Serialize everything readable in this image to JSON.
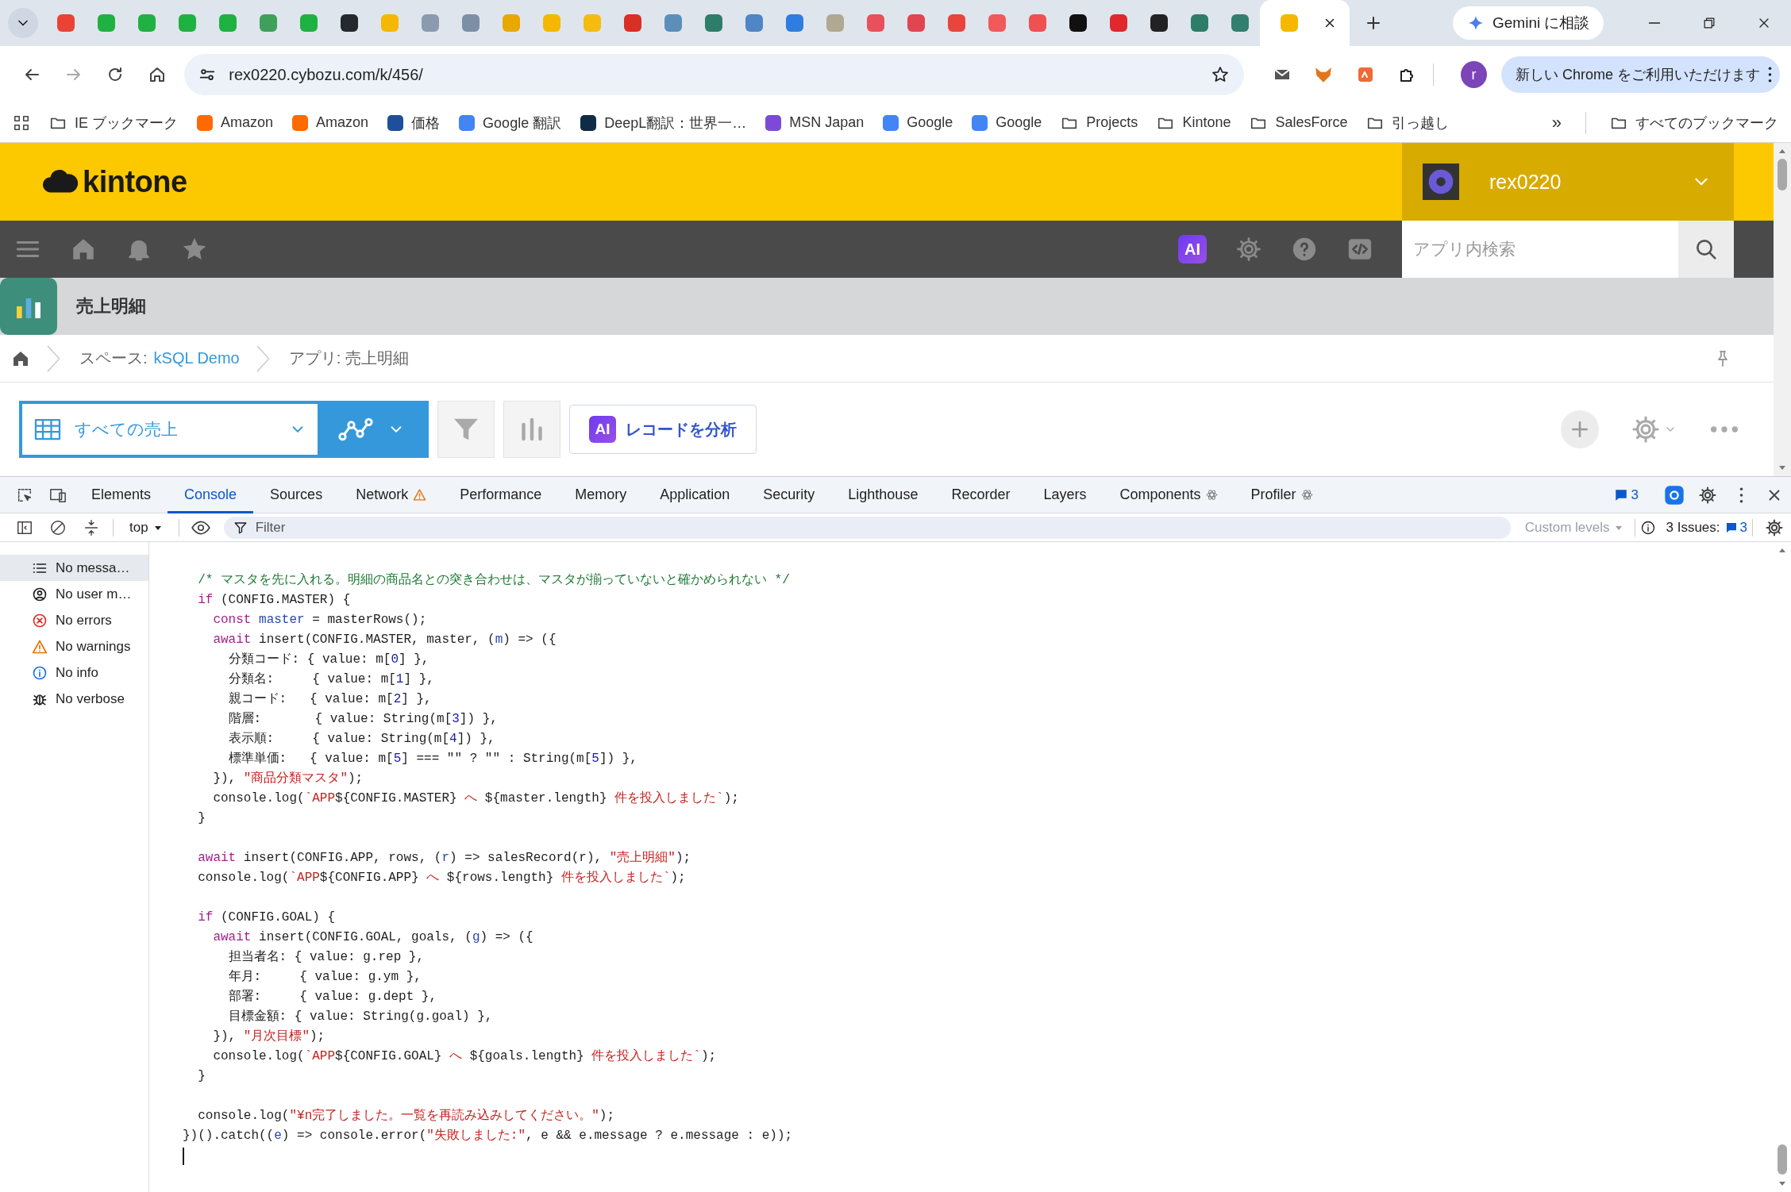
{
  "browser": {
    "tabs": [
      {
        "color": "#ea4335",
        "selected": false
      },
      {
        "color": "#1fb141",
        "selected": false
      },
      {
        "color": "#1fb141",
        "selected": false
      },
      {
        "color": "#1fb141",
        "selected": false
      },
      {
        "color": "#1fb141",
        "selected": false
      },
      {
        "color": "#3fa05a",
        "selected": false
      },
      {
        "color": "#1fb141",
        "selected": false
      },
      {
        "color": "#24292f",
        "selected": false
      },
      {
        "color": "#f6b700",
        "selected": false
      },
      {
        "color": "#8a9bb0",
        "selected": false
      },
      {
        "color": "#7d8fa6",
        "selected": false
      },
      {
        "color": "#e8a800",
        "selected": false
      },
      {
        "color": "#f6b700",
        "selected": false
      },
      {
        "color": "#f5bb10",
        "selected": false
      },
      {
        "color": "#d93025",
        "selected": false
      },
      {
        "color": "#5b8fb9",
        "selected": false
      },
      {
        "color": "#2e7d6b",
        "selected": false
      },
      {
        "color": "#4f86c6",
        "selected": false
      },
      {
        "color": "#2f7de1",
        "selected": false
      },
      {
        "color": "#b0a890",
        "selected": false
      },
      {
        "color": "#e8505b",
        "selected": false
      },
      {
        "color": "#e04550",
        "selected": false
      },
      {
        "color": "#e8453c",
        "selected": false
      },
      {
        "color": "#f05a5a",
        "selected": false
      },
      {
        "color": "#ef5050",
        "selected": false
      },
      {
        "color": "#111111",
        "selected": false
      },
      {
        "color": "#e0282d",
        "selected": false
      },
      {
        "color": "#222222",
        "selected": false
      },
      {
        "color": "#2e7d6b",
        "selected": false
      },
      {
        "color": "#327f70",
        "selected": false
      },
      {
        "color": "#f6b700",
        "selected": true
      }
    ],
    "gemini_button": "Gemini に相談",
    "address": "rex0220.cybozu.com/k/456/",
    "profile_initial": "r",
    "update_button": "新しい Chrome をご利用いただけます",
    "bookmarks": [
      {
        "label": "IE ブックマーク",
        "kind": "folder"
      },
      {
        "label": "Amazon",
        "kind": "site",
        "color": "#ff6a00"
      },
      {
        "label": "Amazon",
        "kind": "site",
        "color": "#ff6a00"
      },
      {
        "label": "価格",
        "kind": "site",
        "color": "#1d4f9c"
      },
      {
        "label": "Google 翻訳",
        "kind": "site",
        "color": "#4285f4"
      },
      {
        "label": "DeepL翻訳：世界一…",
        "kind": "site",
        "color": "#0f2b46"
      },
      {
        "label": "MSN Japan",
        "kind": "site",
        "color": "#7b4bd8"
      },
      {
        "label": "Google",
        "kind": "site",
        "color": "#4285f4"
      },
      {
        "label": "Google",
        "kind": "site",
        "color": "#4285f4"
      },
      {
        "label": "Projects",
        "kind": "folder"
      },
      {
        "label": "Kintone",
        "kind": "folder"
      },
      {
        "label": "SalesForce",
        "kind": "folder"
      },
      {
        "label": "引っ越し",
        "kind": "folder"
      }
    ],
    "more_bookmarks": "»",
    "all_bookmarks": "すべてのブックマーク"
  },
  "kintone": {
    "logo": "kintone",
    "user": "rex0220",
    "ai_badge": "AI",
    "search": {
      "placeholder": "アプリ内検索"
    },
    "app_title": "売上明細",
    "breadcrumb": {
      "space_label": "スペース:",
      "space_link": "kSQL Demo",
      "app": "アプリ: 売上明細"
    },
    "view": "すべての売上",
    "analyze_button": {
      "badge": "AI",
      "label": "レコードを分析"
    }
  },
  "devtools": {
    "tabs": [
      {
        "label": "Elements",
        "kind": "plain",
        "selected": false
      },
      {
        "label": "Console",
        "kind": "plain",
        "selected": true
      },
      {
        "label": "Sources",
        "kind": "plain",
        "selected": false
      },
      {
        "label": "Network",
        "kind": "warning",
        "selected": false
      },
      {
        "label": "Performance",
        "kind": "plain",
        "selected": false
      },
      {
        "label": "Memory",
        "kind": "plain",
        "selected": false
      },
      {
        "label": "Application",
        "kind": "plain",
        "selected": false
      },
      {
        "label": "Security",
        "kind": "plain",
        "selected": false
      },
      {
        "label": "Lighthouse",
        "kind": "plain",
        "selected": false
      },
      {
        "label": "Recorder",
        "kind": "plain",
        "selected": false
      },
      {
        "label": "Layers",
        "kind": "plain",
        "selected": false
      },
      {
        "label": "Components",
        "kind": "react",
        "selected": false
      },
      {
        "label": "Profiler",
        "kind": "react",
        "selected": false
      }
    ],
    "message_count": "3",
    "context": "top",
    "filter": {
      "placeholder": "Filter"
    },
    "levels": {
      "label": "Custom levels",
      "disabled": true
    },
    "issues_label": "3 Issues:",
    "issues_count": "3",
    "sidebar": [
      {
        "label": "No messa…",
        "kind": "list",
        "selected": true
      },
      {
        "label": "No user m…",
        "kind": "user",
        "selected": false
      },
      {
        "label": "No errors",
        "kind": "error",
        "selected": false
      },
      {
        "label": "No warnings",
        "kind": "warning",
        "selected": false
      },
      {
        "label": "No info",
        "kind": "info",
        "selected": false
      },
      {
        "label": "No verbose",
        "kind": "verbose",
        "selected": false
      }
    ],
    "code": [
      {
        "tokens": [
          {
            "kind": "comment",
            "text": "  /* マスタを先に入れる。明細の商品名との突き合わせは、マスタが揃っていないと確かめられない */"
          }
        ]
      },
      {
        "tokens": [
          {
            "kind": "keyword",
            "text": "  if"
          },
          {
            "kind": "plain",
            "text": " (CONFIG.MASTER) {"
          }
        ]
      },
      {
        "tokens": [
          {
            "kind": "keyword",
            "text": "    const"
          },
          {
            "kind": "variable",
            "text": " master"
          },
          {
            "kind": "plain",
            "text": " = masterRows();"
          }
        ]
      },
      {
        "tokens": [
          {
            "kind": "keyword",
            "text": "    await"
          },
          {
            "kind": "plain",
            "text": " insert(CONFIG.MASTER, master, ("
          },
          {
            "kind": "variable",
            "text": "m"
          },
          {
            "kind": "plain",
            "text": ") => ({"
          }
        ]
      },
      {
        "tokens": [
          {
            "kind": "plain",
            "text": "      分類コード: { value: m["
          },
          {
            "kind": "number",
            "text": "0"
          },
          {
            "kind": "plain",
            "text": "] },"
          }
        ]
      },
      {
        "tokens": [
          {
            "kind": "plain",
            "text": "      分類名:     { value: m["
          },
          {
            "kind": "number",
            "text": "1"
          },
          {
            "kind": "plain",
            "text": "] },"
          }
        ]
      },
      {
        "tokens": [
          {
            "kind": "plain",
            "text": "      親コード:   { value: m["
          },
          {
            "kind": "number",
            "text": "2"
          },
          {
            "kind": "plain",
            "text": "] },"
          }
        ]
      },
      {
        "tokens": [
          {
            "kind": "plain",
            "text": "      階層:       { value: String(m["
          },
          {
            "kind": "number",
            "text": "3"
          },
          {
            "kind": "plain",
            "text": "]) },"
          }
        ]
      },
      {
        "tokens": [
          {
            "kind": "plain",
            "text": "      表示順:     { value: String(m["
          },
          {
            "kind": "number",
            "text": "4"
          },
          {
            "kind": "plain",
            "text": "]) },"
          }
        ]
      },
      {
        "tokens": [
          {
            "kind": "plain",
            "text": "      標準単価:   { value: m["
          },
          {
            "kind": "number",
            "text": "5"
          },
          {
            "kind": "plain",
            "text": "] === \"\" ? \"\" : String(m["
          },
          {
            "kind": "number",
            "text": "5"
          },
          {
            "kind": "plain",
            "text": "]) },"
          }
        ]
      },
      {
        "tokens": [
          {
            "kind": "plain",
            "text": "    }), "
          },
          {
            "kind": "string",
            "text": "\"商品分類マスタ\""
          },
          {
            "kind": "plain",
            "text": ");"
          }
        ]
      },
      {
        "tokens": [
          {
            "kind": "plain",
            "text": "    console.log("
          },
          {
            "kind": "string",
            "text": "`APP"
          },
          {
            "kind": "plain",
            "text": "${CONFIG.MASTER}"
          },
          {
            "kind": "string",
            "text": " へ "
          },
          {
            "kind": "plain",
            "text": "${master.length}"
          },
          {
            "kind": "string",
            "text": " 件を投入しました`"
          },
          {
            "kind": "plain",
            "text": ");"
          }
        ]
      },
      {
        "tokens": [
          {
            "kind": "plain",
            "text": "  }"
          }
        ]
      },
      {
        "blank_before": true,
        "tokens": [
          {
            "kind": "keyword",
            "text": "  await"
          },
          {
            "kind": "plain",
            "text": " insert(CONFIG.APP, rows, ("
          },
          {
            "kind": "variable",
            "text": "r"
          },
          {
            "kind": "plain",
            "text": ") => salesRecord(r), "
          },
          {
            "kind": "string",
            "text": "\"売上明細\""
          },
          {
            "kind": "plain",
            "text": ");"
          }
        ]
      },
      {
        "tokens": [
          {
            "kind": "plain",
            "text": "  console.log("
          },
          {
            "kind": "string",
            "text": "`APP"
          },
          {
            "kind": "plain",
            "text": "${CONFIG.APP}"
          },
          {
            "kind": "string",
            "text": " へ "
          },
          {
            "kind": "plain",
            "text": "${rows.length}"
          },
          {
            "kind": "string",
            "text": " 件を投入しました`"
          },
          {
            "kind": "plain",
            "text": ");"
          }
        ]
      },
      {
        "blank_before": true,
        "tokens": [
          {
            "kind": "keyword",
            "text": "  if"
          },
          {
            "kind": "plain",
            "text": " (CONFIG.GOAL) {"
          }
        ]
      },
      {
        "tokens": [
          {
            "kind": "keyword",
            "text": "    await"
          },
          {
            "kind": "plain",
            "text": " insert(CONFIG.GOAL, goals, ("
          },
          {
            "kind": "variable",
            "text": "g"
          },
          {
            "kind": "plain",
            "text": ") => ({"
          }
        ]
      },
      {
        "tokens": [
          {
            "kind": "plain",
            "text": "      担当者名: { value: g.rep },"
          }
        ]
      },
      {
        "tokens": [
          {
            "kind": "plain",
            "text": "      年月:     { value: g.ym },"
          }
        ]
      },
      {
        "tokens": [
          {
            "kind": "plain",
            "text": "      部署:     { value: g.dept },"
          }
        ]
      },
      {
        "tokens": [
          {
            "kind": "plain",
            "text": "      目標金額: { value: String(g.goal) },"
          }
        ]
      },
      {
        "tokens": [
          {
            "kind": "plain",
            "text": "    }), "
          },
          {
            "kind": "string",
            "text": "\"月次目標\""
          },
          {
            "kind": "plain",
            "text": ");"
          }
        ]
      },
      {
        "tokens": [
          {
            "kind": "plain",
            "text": "    console.log("
          },
          {
            "kind": "string",
            "text": "`APP"
          },
          {
            "kind": "plain",
            "text": "${CONFIG.GOAL}"
          },
          {
            "kind": "string",
            "text": " へ "
          },
          {
            "kind": "plain",
            "text": "${goals.length}"
          },
          {
            "kind": "string",
            "text": " 件を投入しました`"
          },
          {
            "kind": "plain",
            "text": ");"
          }
        ]
      },
      {
        "tokens": [
          {
            "kind": "plain",
            "text": "  }"
          }
        ]
      },
      {
        "blank_before": true,
        "tokens": [
          {
            "kind": "plain",
            "text": "  console.log("
          },
          {
            "kind": "string",
            "text": "\"¥n完了しました。一覧を再読み込みしてください。\""
          },
          {
            "kind": "plain",
            "text": ");"
          }
        ]
      },
      {
        "tokens": [
          {
            "kind": "plain",
            "text": "})().catch(("
          },
          {
            "kind": "variable",
            "text": "e"
          },
          {
            "kind": "plain",
            "text": ") => console.error("
          },
          {
            "kind": "string",
            "text": "\"失敗しました:\""
          },
          {
            "kind": "plain",
            "text": ", e && e.message ? e.message : e));"
          }
        ]
      }
    ]
  }
}
